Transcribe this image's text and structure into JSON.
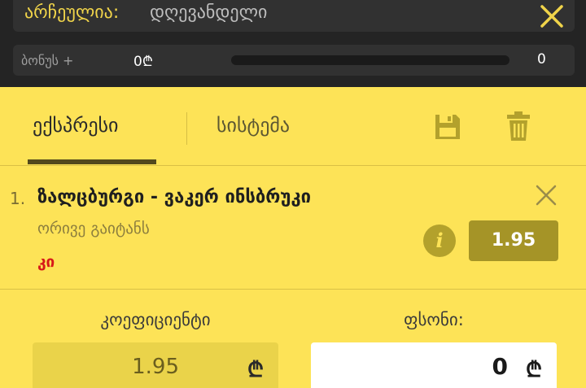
{
  "selection": {
    "label": "არჩეულია:",
    "value": "დღევანდელი"
  },
  "bonus": {
    "label": "ბონუს +",
    "amount": "0₾",
    "count": "0",
    "progress": 0.0
  },
  "tabs": [
    {
      "label": "ექსპრესი",
      "active": true
    },
    {
      "label": "სისტემა",
      "active": false
    }
  ],
  "icons": {
    "close": "close-icon",
    "save": "save-icon",
    "trash": "trash-icon",
    "info": "info-icon"
  },
  "event": {
    "number": "1.",
    "title": "ზალცბურგი - ვაკერ ინსბრუკი",
    "market": "ორივე გაიტანს",
    "pick": "კი",
    "odds": "1.95",
    "info_glyph": "i"
  },
  "coefficient": {
    "label": "კოეფიციენტი",
    "value": "1.95",
    "currency": "₾"
  },
  "stake": {
    "label": "ფსონი:",
    "value": "0",
    "currency": "₾"
  },
  "colors": {
    "background": "#fde357",
    "header": "#242424",
    "accent": "#f0d44a",
    "odds_button": "#a59427",
    "pick": "#d71919"
  }
}
